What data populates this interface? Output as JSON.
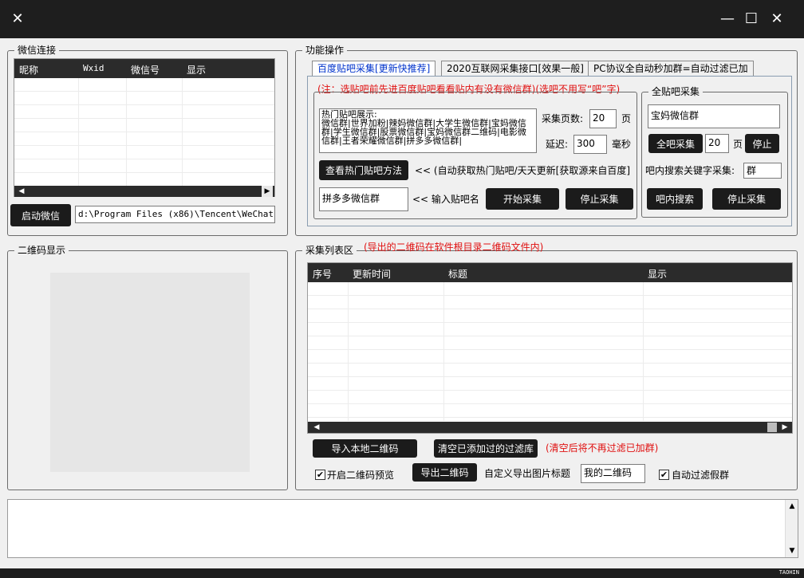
{
  "titlebar": {
    "close_left": "✕",
    "minimize": "—",
    "maximize": "☐",
    "close_right": "✕"
  },
  "wechat_group": {
    "title": "微信连接",
    "columns": [
      "昵称",
      "Wxid",
      "微信号",
      "显示"
    ],
    "start_button": "启动微信",
    "path_value": "d:\\Program Files (x86)\\Tencent\\WeChat"
  },
  "function_group": {
    "title": "功能操作",
    "tabs": [
      "百度贴吧采集[更新快推荐]",
      "2020互联网采集接口[效果一般]",
      "PC协议全自动秒加群=自动过滤已加"
    ],
    "note": "(注：选贴吧前先进百度贴吧看看贴内有没有微信群)(选吧不用写“吧”字)",
    "hot_text": "热门贴吧展示:\n微信群|世界加粉|辣妈微信群|大学生微信群|宝妈微信群|学生微信群|股票微信群|宝妈微信群二维码|电影微信群|王者荣耀微信群|拼多多微信群|",
    "pages_label": "采集页数:",
    "pages_value": "20",
    "pages_unit": "页",
    "delay_label": "延迟:",
    "delay_value": "300",
    "delay_unit": "毫秒",
    "view_hot_button": "查看热门贴吧方法",
    "auto_hint": "<< (自动获取热门贴吧/天天更新[获取源来自百度]",
    "bar_name_value": "拼多多微信群",
    "bar_name_hint": "<< 输入贴吧名",
    "start_collect": "开始采集",
    "stop_collect": "停止采集"
  },
  "allbar_group": {
    "title": "全贴吧采集",
    "keyword_value": "宝妈微信群",
    "all_collect": "全吧采集",
    "pages_value": "20",
    "pages_unit": "页",
    "stop_button": "停止",
    "search_label": "吧内搜索关键字采集:",
    "search_value": "群",
    "search_button": "吧内搜索",
    "stop_collect": "停止采集"
  },
  "qr_group": {
    "title": "二维码显示"
  },
  "list_group": {
    "title": "采集列表区",
    "title_note": "(导出的二维码在软件根目录二维码文件内)",
    "columns": [
      "序号",
      "更新时间",
      "标题",
      "显示"
    ],
    "import_button": "导入本地二维码",
    "clear_button": "清空已添加过的过滤库",
    "clear_note": "(清空后将不再过滤已加群)",
    "preview_label": "开启二维码预览",
    "export_button": "导出二维码",
    "export_title_label": "自定义导出图片标题",
    "export_title_value": "我的二维码",
    "auto_filter_label": "自动过滤假群"
  },
  "footer": {
    "brand": "TAOHIN"
  },
  "colors": {
    "dark": "#1b1b1b",
    "accent_red": "#e01010",
    "link_blue": "#0033cc"
  }
}
